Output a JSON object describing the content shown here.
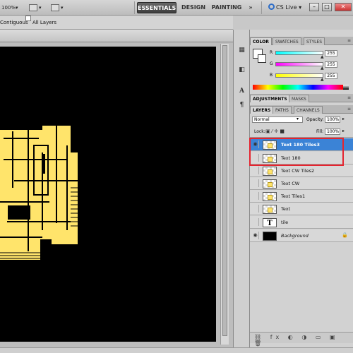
{
  "appbar": {
    "zoom": "100%",
    "workspaces": [
      "ESSENTIALS",
      "DESIGN",
      "PAINTING"
    ],
    "more": "»",
    "cs_live": "CS Live",
    "minimize": "–",
    "restore": "□"
  },
  "options": {
    "contiguous_label": "Contiguous",
    "all_layers_label": "All Layers"
  },
  "color_panel": {
    "tabs": [
      "COLOR",
      "SWATCHES",
      "STYLES"
    ],
    "channels": [
      {
        "label": "R",
        "value": "255"
      },
      {
        "label": "G",
        "value": "255"
      },
      {
        "label": "B",
        "value": "255"
      }
    ],
    "colors": {
      "r_slider": "#ff3030",
      "g_slider": "#ff40ff",
      "b_slider": "#ffff40"
    }
  },
  "adjustments_panel": {
    "tabs": [
      "ADJUSTMENTS",
      "MASKS"
    ]
  },
  "layers_panel": {
    "tabs": [
      "LAYERS",
      "PATHS",
      "CHANNELS"
    ],
    "blend_mode": "Normal",
    "opacity_label": "Opacity:",
    "opacity_value": "100%",
    "lock_label": "Lock:",
    "fill_label": "Fill:",
    "fill_value": "100%",
    "layers": [
      {
        "name": "Text 180 Tiles3",
        "selected": true
      },
      {
        "name": "Text 180"
      },
      {
        "name": "Text CW Tiles2"
      },
      {
        "name": "Text CW"
      },
      {
        "name": "Text Tiles1"
      },
      {
        "name": "Text"
      },
      {
        "name": "tile"
      },
      {
        "name": "Background"
      }
    ],
    "selection_highlight": "#e5242f"
  }
}
